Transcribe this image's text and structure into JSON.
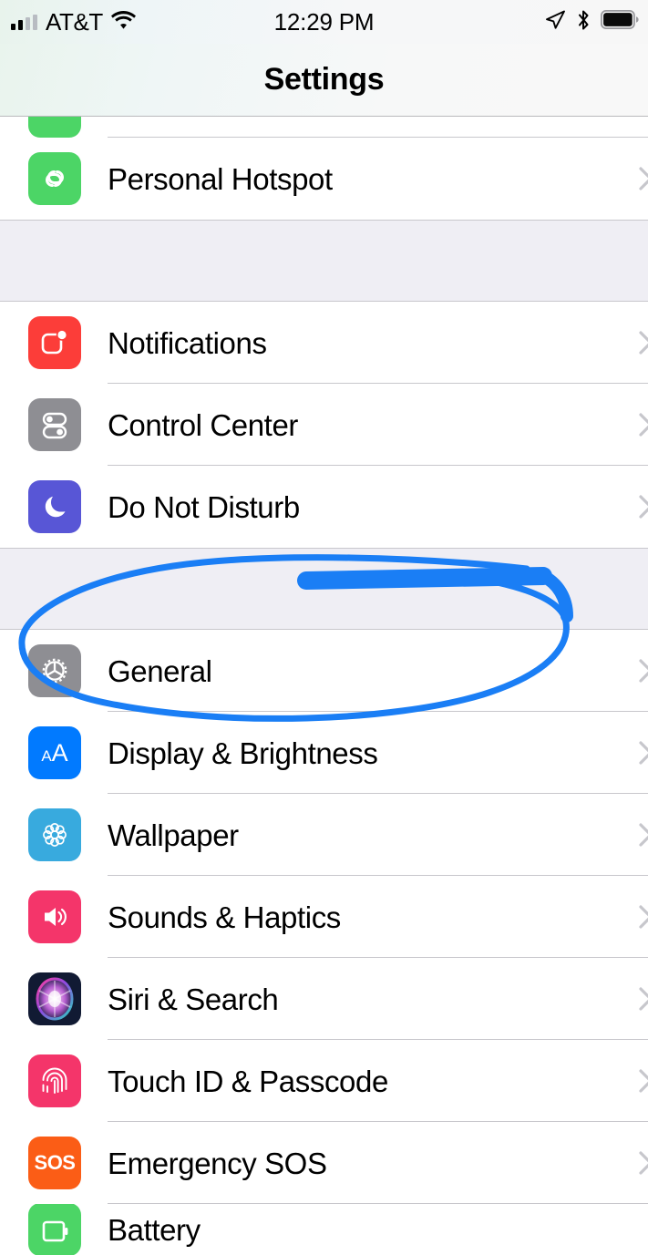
{
  "status_bar": {
    "carrier": "AT&T",
    "time": "12:29 PM",
    "signal_bars_filled": 2,
    "signal_bars_total": 4,
    "icons": [
      "signal-bars-icon",
      "wifi-icon",
      "location-arrow-icon",
      "bluetooth-icon",
      "battery-icon"
    ],
    "battery_full": true
  },
  "header": {
    "title": "Settings"
  },
  "colors": {
    "annotation_blue": "#1a7ef5",
    "row_background": "#ffffff",
    "group_gap_background": "#efeef4",
    "separator": "#c8c7cc",
    "chevron": "#c7c7cc",
    "label_text": "#000000"
  },
  "groups": [
    {
      "id": "connectivity",
      "rows": [
        {
          "label": "Personal Hotspot",
          "icon": "hotspot-icon",
          "icon_color": "#4cd566",
          "chevron": true
        }
      ]
    },
    {
      "id": "alerts",
      "rows": [
        {
          "label": "Notifications",
          "icon": "notifications-icon",
          "icon_color": "#fc3d39",
          "chevron": true
        },
        {
          "label": "Control Center",
          "icon": "control-center-icon",
          "icon_color": "#8e8e93",
          "chevron": true
        },
        {
          "label": "Do Not Disturb",
          "icon": "moon-icon",
          "icon_color": "#5856d6",
          "chevron": true
        }
      ]
    },
    {
      "id": "system",
      "rows": [
        {
          "label": "General",
          "icon": "gear-icon",
          "icon_color": "#8e8e93",
          "chevron": true,
          "annotated": true
        },
        {
          "label": "Display & Brightness",
          "icon": "display-brightness-icon",
          "icon_color": "#017aff",
          "chevron": true
        },
        {
          "label": "Wallpaper",
          "icon": "wallpaper-flower-icon",
          "icon_color": "#38aade",
          "chevron": true
        },
        {
          "label": "Sounds & Haptics",
          "icon": "speaker-icon",
          "icon_color": "#f4356a",
          "chevron": true
        },
        {
          "label": "Siri & Search",
          "icon": "siri-orb-icon",
          "icon_color": "#111a33",
          "chevron": true
        },
        {
          "label": "Touch ID & Passcode",
          "icon": "fingerprint-icon",
          "icon_color": "#f4356a",
          "chevron": true
        },
        {
          "label": "Emergency SOS",
          "icon": "sos-icon",
          "icon_color": "#fb5d16",
          "chevron": true
        },
        {
          "label": "Battery",
          "icon": "battery-green-icon",
          "icon_color": "#4cd566",
          "chevron": false
        }
      ]
    }
  ],
  "annotation": {
    "type": "hand-drawn-ellipse-highlight",
    "color": "#1a7ef5",
    "target_row": "General",
    "description": "Blue hand-drawn ellipse circling the General row with a thick horizontal underline stroke above it"
  }
}
